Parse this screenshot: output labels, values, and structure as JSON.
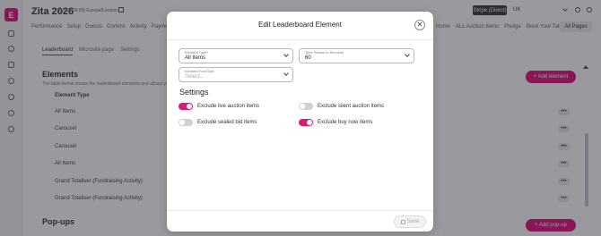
{
  "app": {
    "logo_letter": "E"
  },
  "header": {
    "title": "Zita 2026",
    "subtitle": "(UTC+00:00) Europe/London",
    "stripe_label": "Stripe (Direct)",
    "region": "UK",
    "nav": [
      "Performance",
      "Setup",
      "Guests",
      "Comms",
      "Activity",
      "Payments"
    ],
    "nav_right": [
      "Home",
      "ALL Auction Items",
      "Pledge",
      "Book Your Table"
    ],
    "all_pages": "All Pages"
  },
  "subtabs": [
    "Leaderboard",
    "Microsite page",
    "Settings"
  ],
  "elements": {
    "title": "Elements",
    "description": "The table below shows the leaderboard elements and allows you to add",
    "column_header": "Element Type",
    "add_button": "+ Add element",
    "rows": [
      "All Items",
      "Carousel",
      "Carousel",
      "All Items",
      "Grand Totaliser (Fundraising Activity)",
      "Grand Totaliser (Fundraising Activity)"
    ],
    "row_action": "•••"
  },
  "popups": {
    "title": "Pop-ups",
    "add_button": "+ Add pop-up"
  },
  "modal": {
    "title": "Edit Leaderboard Element",
    "close_symbol": "✕",
    "element_type": {
      "label": "Element Type",
      "required_mark": "*",
      "value": "All Items"
    },
    "time_shown": {
      "label": "Time Shown In Seconds",
      "value": "60"
    },
    "element_font_size": {
      "label": "Element Font Size",
      "placeholder": "Select..."
    },
    "settings_heading": "Settings",
    "toggles": [
      {
        "label": "Exclude live auction items",
        "on": true
      },
      {
        "label": "Exclude silent auction items",
        "on": false
      },
      {
        "label": "Exclude sealed bid items",
        "on": false
      },
      {
        "label": "Exclude buy now items",
        "on": true
      }
    ],
    "save_label": "Save"
  },
  "colors": {
    "accent": "#e0127c",
    "toggle_on": "#d81b7a",
    "toggle_off": "#cfcfd6"
  }
}
